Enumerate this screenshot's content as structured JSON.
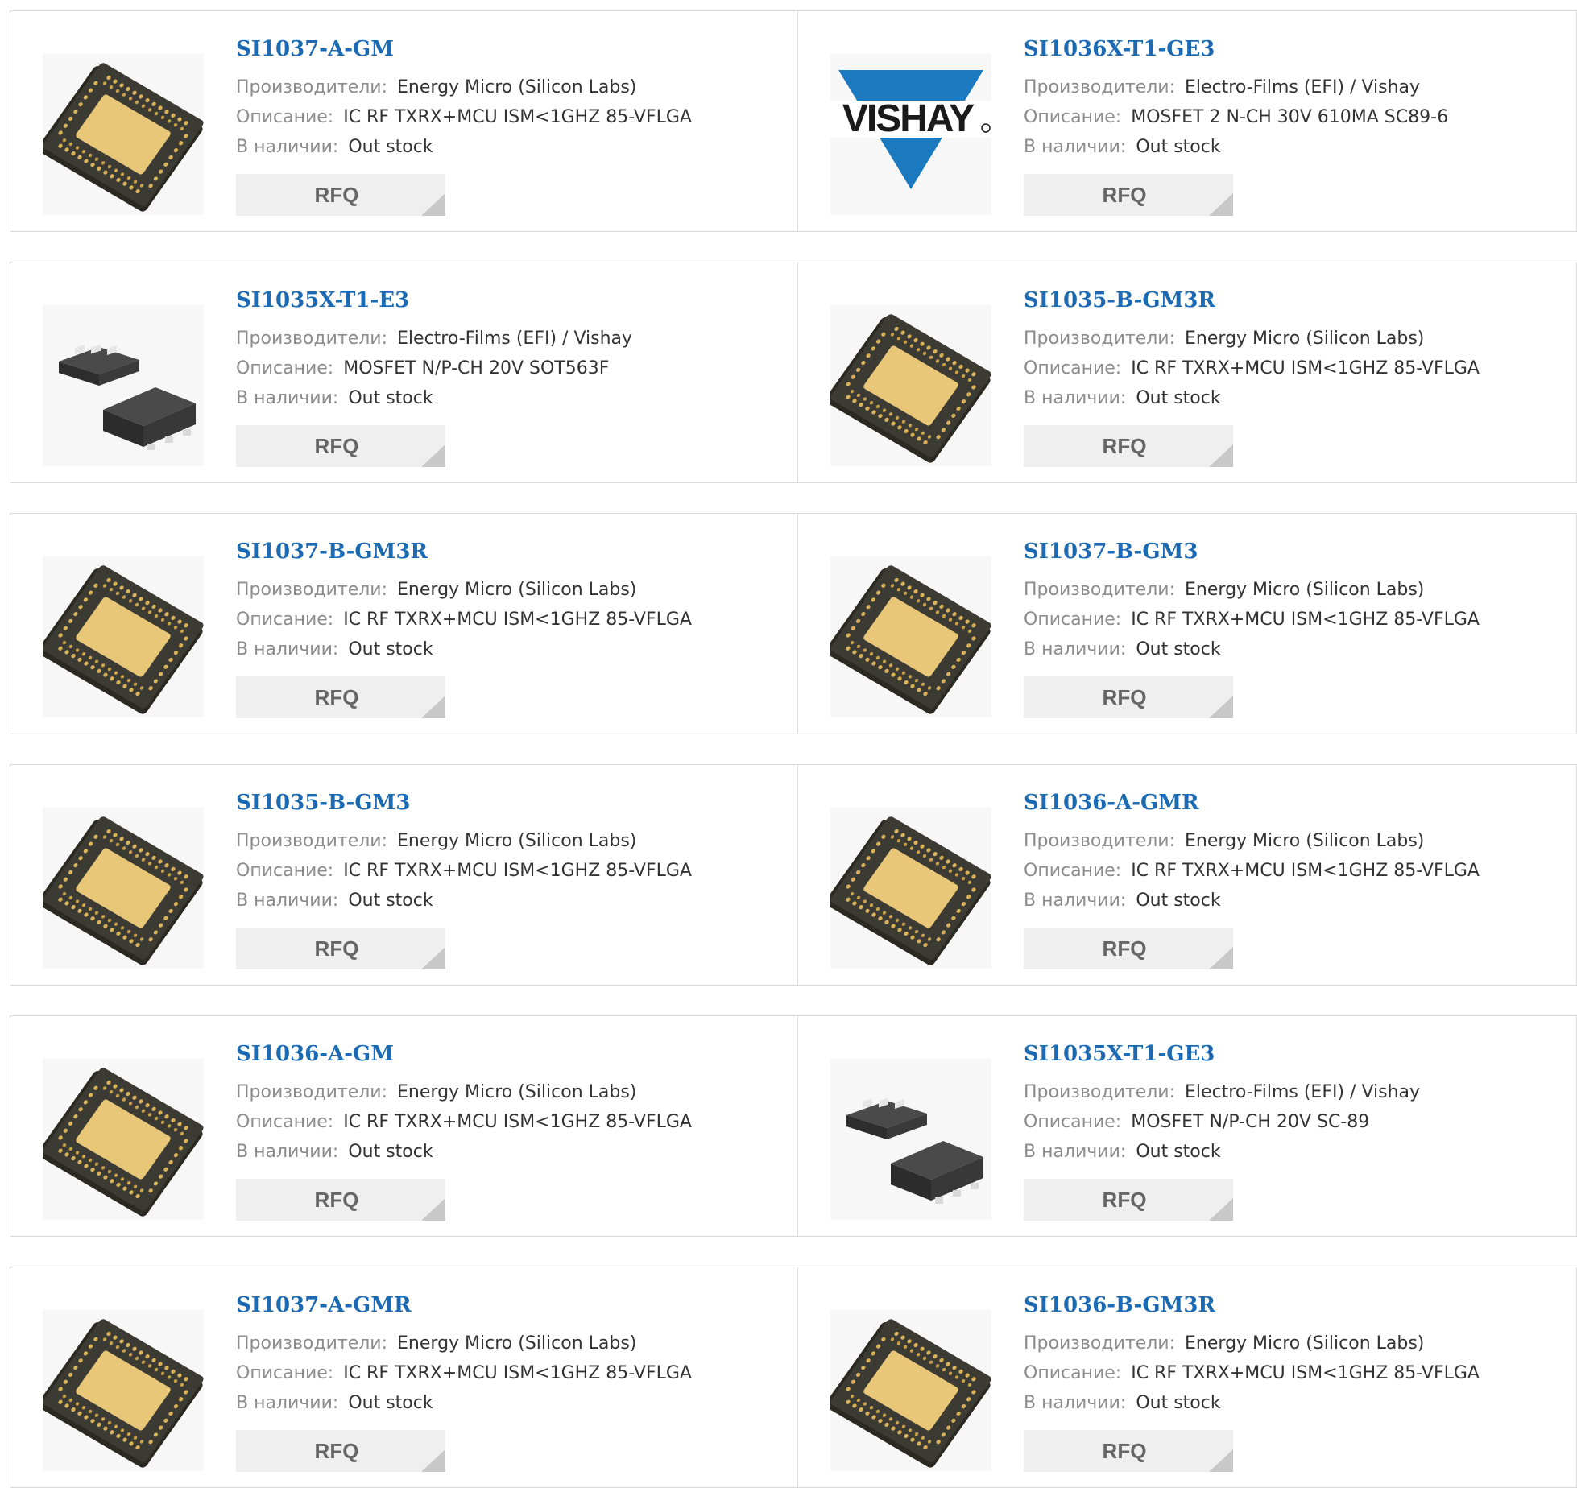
{
  "labels": {
    "manufacturer": "Производители:",
    "description": "Описание:",
    "stock": "В наличии:",
    "rfq": "RFQ"
  },
  "colors": {
    "title": "#1b6ab3",
    "rfq_bg": "#efefef",
    "vishay_blue": "#1b79c0"
  },
  "rows": [
    {
      "left": {
        "title": "SI1037-A-GM",
        "manufacturer": "Energy Micro (Silicon Labs)",
        "description": "IC RF TXRX+MCU ISM<1GHZ 85-VFLGA",
        "stock": "Out stock",
        "image": "vflga-chip-icon"
      },
      "right": {
        "title": "SI1036X-T1-GE3",
        "manufacturer": "Electro-Films (EFI) / Vishay",
        "description": "MOSFET 2 N-CH 30V 610MA SC89-6",
        "stock": "Out stock",
        "image": "vishay-logo",
        "logo_text": "VISHAY"
      }
    },
    {
      "left": {
        "title": "SI1035X-T1-E3",
        "manufacturer": "Electro-Films (EFI) / Vishay",
        "description": "MOSFET N/P-CH 20V SOT563F",
        "stock": "Out stock",
        "image": "sot-package-icon"
      },
      "right": {
        "title": "SI1035-B-GM3R",
        "manufacturer": "Energy Micro (Silicon Labs)",
        "description": "IC RF TXRX+MCU ISM<1GHZ 85-VFLGA",
        "stock": "Out stock",
        "image": "vflga-chip-icon"
      }
    },
    {
      "left": {
        "title": "SI1037-B-GM3R",
        "manufacturer": "Energy Micro (Silicon Labs)",
        "description": "IC RF TXRX+MCU ISM<1GHZ 85-VFLGA",
        "stock": "Out stock",
        "image": "vflga-chip-icon"
      },
      "right": {
        "title": "SI1037-B-GM3",
        "manufacturer": "Energy Micro (Silicon Labs)",
        "description": "IC RF TXRX+MCU ISM<1GHZ 85-VFLGA",
        "stock": "Out stock",
        "image": "vflga-chip-icon"
      }
    },
    {
      "left": {
        "title": "SI1035-B-GM3",
        "manufacturer": "Energy Micro (Silicon Labs)",
        "description": "IC RF TXRX+MCU ISM<1GHZ 85-VFLGA",
        "stock": "Out stock",
        "image": "vflga-chip-icon"
      },
      "right": {
        "title": "SI1036-A-GMR",
        "manufacturer": "Energy Micro (Silicon Labs)",
        "description": "IC RF TXRX+MCU ISM<1GHZ 85-VFLGA",
        "stock": "Out stock",
        "image": "vflga-chip-icon"
      }
    },
    {
      "left": {
        "title": "SI1036-A-GM",
        "manufacturer": "Energy Micro (Silicon Labs)",
        "description": "IC RF TXRX+MCU ISM<1GHZ 85-VFLGA",
        "stock": "Out stock",
        "image": "vflga-chip-icon"
      },
      "right": {
        "title": "SI1035X-T1-GE3",
        "manufacturer": "Electro-Films (EFI) / Vishay",
        "description": "MOSFET N/P-CH 20V SC-89",
        "stock": "Out stock",
        "image": "sot-package-icon"
      }
    },
    {
      "left": {
        "title": "SI1037-A-GMR",
        "manufacturer": "Energy Micro (Silicon Labs)",
        "description": "IC RF TXRX+MCU ISM<1GHZ 85-VFLGA",
        "stock": "Out stock",
        "image": "vflga-chip-icon"
      },
      "right": {
        "title": "SI1036-B-GM3R",
        "manufacturer": "Energy Micro (Silicon Labs)",
        "description": "IC RF TXRX+MCU ISM<1GHZ 85-VFLGA",
        "stock": "Out stock",
        "image": "vflga-chip-icon"
      }
    }
  ]
}
